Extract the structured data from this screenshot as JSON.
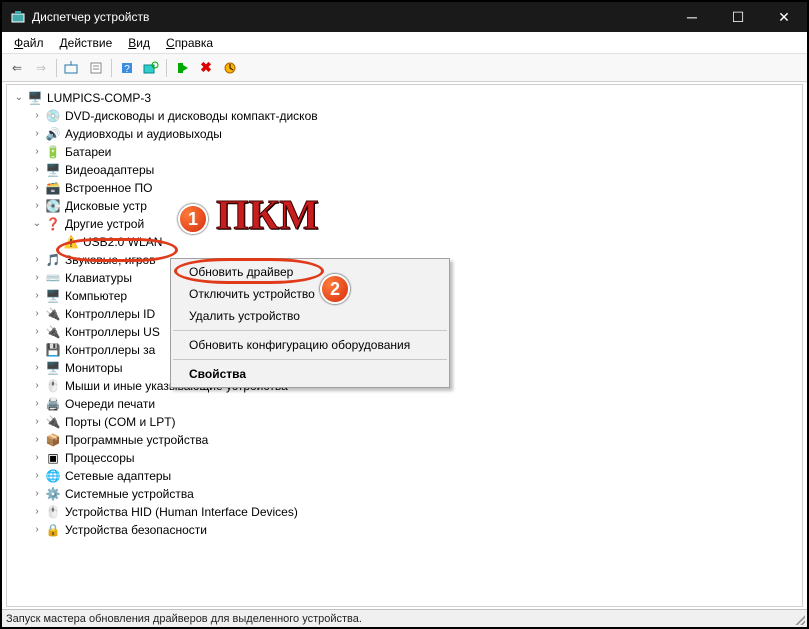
{
  "window": {
    "title": "Диспетчер устройств"
  },
  "menu": {
    "file": "Файл",
    "action": "Действие",
    "view": "Вид",
    "help": "Справка"
  },
  "tree": {
    "root": "LUMPICS-COMP-3",
    "items": [
      "DVD-дисководы и дисководы компакт-дисков",
      "Аудиовходы и аудиовыходы",
      "Батареи",
      "Видеоадаптеры",
      "Встроенное ПО",
      "Дисковые устр",
      "Другие устрой",
      "Звуковые, игров",
      "Клавиатуры",
      "Компьютер",
      "Контроллеры ID",
      "Контроллеры US",
      "Контроллеры за",
      "Мониторы",
      "Мыши и иные указывающие устройства",
      "Очереди печати",
      "Порты (COM и LPT)",
      "Программные устройства",
      "Процессоры",
      "Сетевые адаптеры",
      "Системные устройства",
      "Устройства HID (Human Interface Devices)",
      "Устройства безопасности"
    ],
    "selected_child": "USB2.0 WLAN"
  },
  "context_menu": {
    "update": "Обновить драйвер",
    "disable": "Отключить устройство",
    "remove": "Удалить устройство",
    "rescan": "Обновить конфигурацию оборудования",
    "props": "Свойства"
  },
  "annotation": {
    "label": "ПКМ",
    "badge1": "1",
    "badge2": "2"
  },
  "status": "Запуск мастера обновления драйверов для выделенного устройства."
}
